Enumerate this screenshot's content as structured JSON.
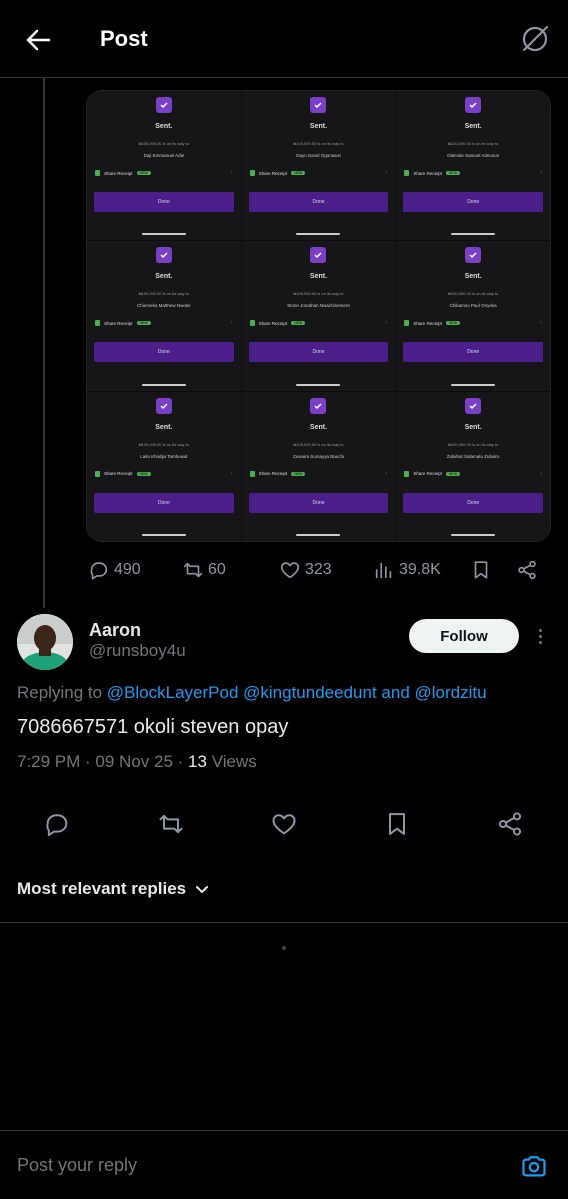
{
  "header": {
    "title": "Post"
  },
  "media": {
    "receipts": [
      {
        "sent": "Sent.",
        "amount": "₦100,000.00 is on its way to",
        "name": "Daji Emmanuel Adie",
        "share": "Share Receipt",
        "new": "NEW",
        "done": "Done"
      },
      {
        "sent": "Sent.",
        "amount": "₦100,000.00 is on its way to",
        "name": "Dayo David Ogunwusi",
        "share": "Share Receipt",
        "new": "NEW",
        "done": "Done"
      },
      {
        "sent": "Sent.",
        "amount": "₦100,000.00 is on its way to",
        "name": "Olamide Samuel Adeosun",
        "share": "Share Receipt",
        "new": "NEW",
        "done": "Done"
      },
      {
        "sent": "Sent.",
        "amount": "₦100,000.00 is on its way to",
        "name": "Chiemeka Matthew Nwoke",
        "share": "Share Receipt",
        "new": "NEW",
        "done": "Done"
      },
      {
        "sent": "Sent.",
        "amount": "₦100,000.00 is on its way to",
        "name": "Stone Jonathan Nwachinemere",
        "share": "Share Receipt",
        "new": "NEW",
        "done": "Done"
      },
      {
        "sent": "Sent.",
        "amount": "₦100,000.00 is on its way to",
        "name": "Chikamso Paul Onyeka",
        "share": "Share Receipt",
        "new": "NEW",
        "done": "Done"
      },
      {
        "sent": "Sent.",
        "amount": "₦100,000.00 is on its way to",
        "name": "Laila Khadija Tambuwal",
        "share": "Share Receipt",
        "new": "NEW",
        "done": "Done"
      },
      {
        "sent": "Sent.",
        "amount": "₦100,000.00 is on its way to",
        "name": "Zuwaira Sumayya Bauchi",
        "share": "Share Receipt",
        "new": "NEW",
        "done": "Done"
      },
      {
        "sent": "Sent.",
        "amount": "₦100,000.00 is on its way to",
        "name": "Zulaihat Salamatu Zubairu",
        "share": "Share Receipt",
        "new": "NEW",
        "done": "Done"
      }
    ]
  },
  "parent_stats": {
    "replies": "490",
    "reposts": "60",
    "likes": "323",
    "views": "39.8K"
  },
  "reply_post": {
    "name": "Aaron",
    "handle": "@runsboy4u",
    "follow_label": "Follow",
    "replying_prefix": "Replying to",
    "mention_1": "@BlockLayerPod",
    "mention_2": "@kingtundeedunt",
    "and_word": "and",
    "mention_3": "@lordzitu",
    "text": "7086667571 okoli steven opay",
    "time": "7:29 PM",
    "date": "09 Nov 25",
    "views_count": "13",
    "views_label": "Views"
  },
  "sort": {
    "label": "Most relevant replies"
  },
  "composer": {
    "placeholder": "Post your reply"
  }
}
